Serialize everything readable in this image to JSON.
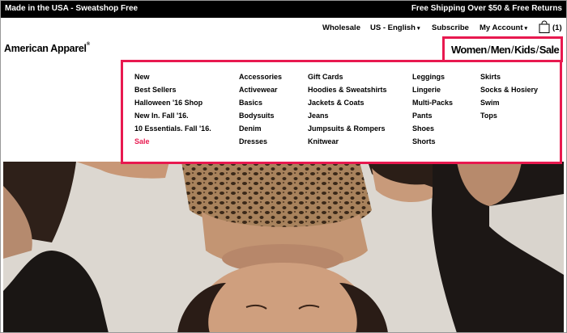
{
  "topbar": {
    "left_text": "Made in the USA - Sweatshop Free",
    "right_text": "Free Shipping Over $50 & Free Returns"
  },
  "header": {
    "logo": "American Apparel",
    "logo_mark": "®",
    "wholesale": "Wholesale",
    "language": "US - English",
    "subscribe": "Subscribe",
    "account": "My Account",
    "cart_count": "(1)",
    "icons": [
      "chevron-down-icon",
      "shopping-bag-icon"
    ]
  },
  "gender_nav": {
    "items": [
      "Women",
      "Men",
      "Kids",
      "Sale"
    ],
    "separator": "/"
  },
  "menu": {
    "columns": [
      [
        "New",
        "Best Sellers",
        "Halloween '16 Shop",
        "New In. Fall '16.",
        "10 Essentials. Fall '16.",
        "Sale"
      ],
      [
        "Accessories",
        "Activewear",
        "Basics",
        "Bodysuits",
        "Denim",
        "Dresses"
      ],
      [
        "Gift Cards",
        "Hoodies & Sweatshirts",
        "Jackets & Coats",
        "Jeans",
        "Jumpsuits & Rompers",
        "Knitwear"
      ],
      [
        "Leggings",
        "Lingerie",
        "Multi-Packs",
        "Pants",
        "Shoes",
        "Shorts"
      ],
      [
        "Skirts",
        "Socks & Hosiery",
        "Swim",
        "Tops"
      ]
    ]
  },
  "colors": {
    "accent": "#e8194f",
    "topbar_bg": "#000000"
  }
}
